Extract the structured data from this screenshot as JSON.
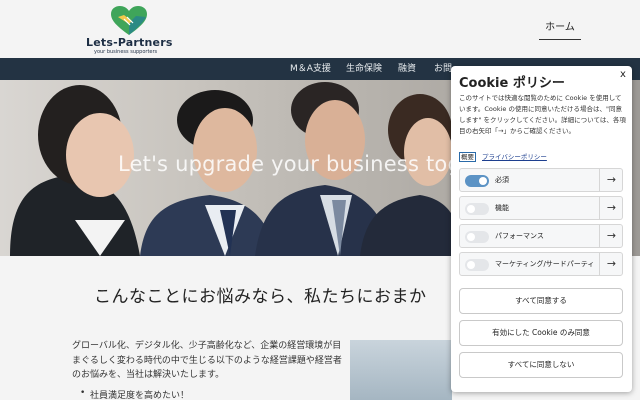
{
  "header": {
    "logo_text": "Lets-Partners",
    "logo_tagline": "your business supporters",
    "home_label": "ホーム"
  },
  "nav": {
    "items": [
      "M＆A支援",
      "生命保険",
      "融資",
      "お問"
    ]
  },
  "hero": {
    "text": "Let's upgrade your business tog"
  },
  "content": {
    "title": "こんなことにお悩みなら、私たちにおまか",
    "paragraph": "グローバル化、デジタル化、少子高齢化など、企業の経営環境が目まぐるしく変わる時代の中で生じる以下のような経営課題や経営者のお悩みを、当社は解決いたします。",
    "bullet": "社員満足度を高めたい！"
  },
  "cookie": {
    "title": "Cookie ポリシー",
    "close": "x",
    "description": "このサイトでは快適な閲覧のために Cookie を使用しています。Cookie の使用に同意いただける場合は、\"同意します\" をクリックしてください。詳細については、各項目の右矢印「→」からご確認ください。",
    "summary_link": "概要",
    "privacy_link": "プライバシーポリシー",
    "categories": [
      {
        "label": "必須",
        "enabled": true
      },
      {
        "label": "機能",
        "enabled": false
      },
      {
        "label": "パフォーマンス",
        "enabled": false
      },
      {
        "label": "マーケティング/サードパーティ",
        "enabled": false
      }
    ],
    "arrow": "→",
    "buttons": {
      "accept_all": "すべて同意する",
      "accept_enabled": "有効にした Cookie のみ同意",
      "decline_all": "すべてに同意しない"
    }
  },
  "colors": {
    "nav_bg": "#233343",
    "toggle_on": "#5c93c5",
    "logo_green": "#3fa55a",
    "logo_teal": "#2b8a84"
  }
}
